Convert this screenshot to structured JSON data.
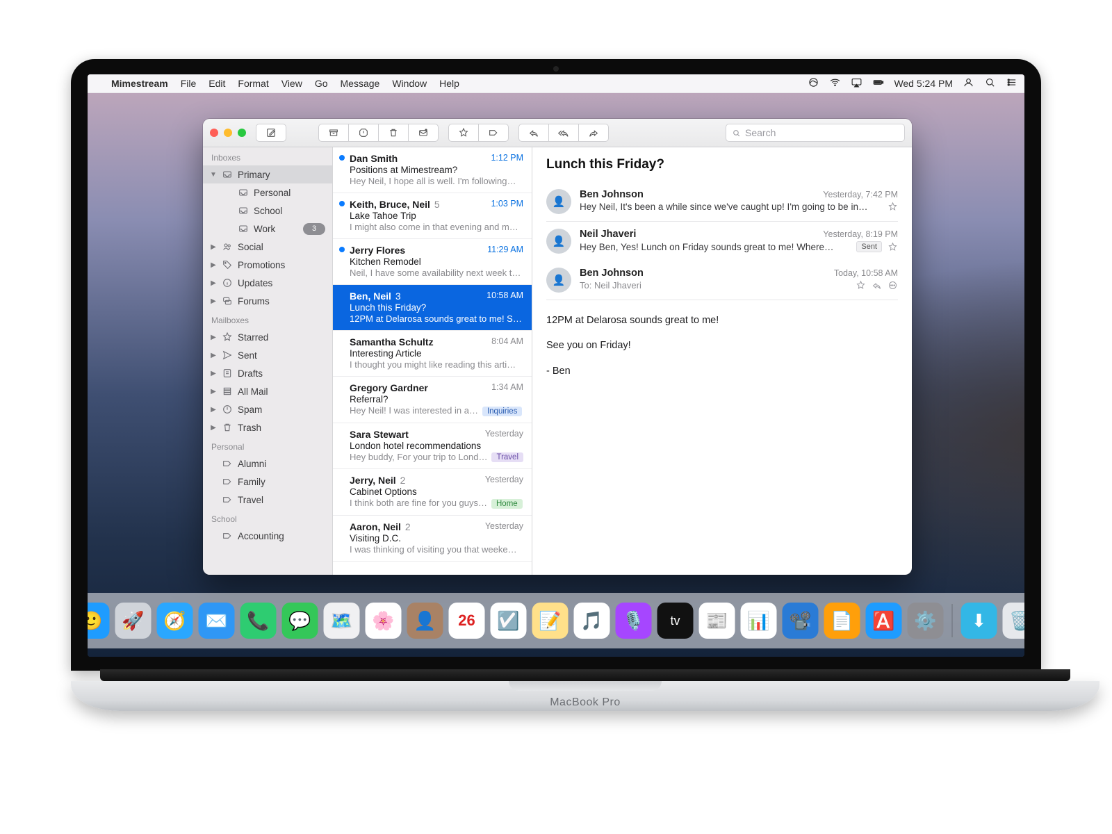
{
  "menubar": {
    "app": "Mimestream",
    "items": [
      "File",
      "Edit",
      "Format",
      "View",
      "Go",
      "Message",
      "Window",
      "Help"
    ],
    "clock": "Wed 5:24 PM"
  },
  "search": {
    "placeholder": "Search"
  },
  "sidebar": {
    "groups": [
      {
        "title": "Inboxes",
        "items": [
          {
            "label": "Primary",
            "icon": "tray",
            "chev": "down",
            "sel": true
          },
          {
            "label": "Personal",
            "icon": "tray",
            "indent": true
          },
          {
            "label": "School",
            "icon": "tray",
            "indent": true
          },
          {
            "label": "Work",
            "icon": "tray",
            "indent": true,
            "badge": "3"
          },
          {
            "label": "Social",
            "icon": "people",
            "chev": "right"
          },
          {
            "label": "Promotions",
            "icon": "tag",
            "chev": "right"
          },
          {
            "label": "Updates",
            "icon": "info",
            "chev": "right"
          },
          {
            "label": "Forums",
            "icon": "forum",
            "chev": "right"
          }
        ]
      },
      {
        "title": "Mailboxes",
        "items": [
          {
            "label": "Starred",
            "icon": "star",
            "chev": "right"
          },
          {
            "label": "Sent",
            "icon": "send",
            "chev": "right"
          },
          {
            "label": "Drafts",
            "icon": "draft",
            "chev": "right"
          },
          {
            "label": "All Mail",
            "icon": "stack",
            "chev": "right"
          },
          {
            "label": "Spam",
            "icon": "spam",
            "chev": "right"
          },
          {
            "label": "Trash",
            "icon": "trash",
            "chev": "right"
          }
        ]
      },
      {
        "title": "Personal",
        "items": [
          {
            "label": "Alumni",
            "icon": "label"
          },
          {
            "label": "Family",
            "icon": "label"
          },
          {
            "label": "Travel",
            "icon": "label"
          }
        ]
      },
      {
        "title": "School",
        "items": [
          {
            "label": "Accounting",
            "icon": "label"
          }
        ]
      }
    ]
  },
  "messages": [
    {
      "unread": true,
      "from": "Dan Smith",
      "subject": "Positions at Mimestream?",
      "preview": "Hey Neil, I hope all is well. I'm following…",
      "time": "1:12 PM"
    },
    {
      "unread": true,
      "from": "Keith, Bruce, Neil",
      "count": "5",
      "subject": "Lake Tahoe Trip",
      "preview": "I might also come in that evening and m…",
      "time": "1:03 PM"
    },
    {
      "unread": true,
      "from": "Jerry Flores",
      "subject": "Kitchen Remodel",
      "preview": "Neil, I have some availability next week t…",
      "time": "11:29 AM"
    },
    {
      "sel": true,
      "from": "Ben, Neil",
      "count": "3",
      "subject": "Lunch this Friday?",
      "preview": "12PM at Delarosa sounds great to me! S…",
      "time": "10:58 AM"
    },
    {
      "from": "Samantha Schultz",
      "subject": "Interesting Article",
      "preview": "I thought you might like reading this arti…",
      "time": "8:04 AM"
    },
    {
      "from": "Gregory Gardner",
      "subject": "Referral?",
      "preview": "Hey Neil! I was interested in a…",
      "time": "1:34 AM",
      "tag": {
        "text": "Inquiries",
        "bg": "#d9e6fb",
        "fg": "#2b5db0"
      }
    },
    {
      "from": "Sara Stewart",
      "subject": "London hotel recommendations",
      "preview": "Hey buddy, For your trip to Lond…",
      "time": "Yesterday",
      "tag": {
        "text": "Travel",
        "bg": "#e6def5",
        "fg": "#6b4fa8"
      }
    },
    {
      "from": "Jerry, Neil",
      "count": "2",
      "subject": "Cabinet Options",
      "preview": "I think both are fine for you guys…",
      "time": "Yesterday",
      "tag": {
        "text": "Home",
        "bg": "#d7f0d8",
        "fg": "#2f8a3f"
      }
    },
    {
      "from": "Aaron, Neil",
      "count": "2",
      "subject": "Visiting D.C.",
      "preview": "I was thinking of visiting you that weeke…",
      "time": "Yesterday"
    }
  ],
  "reader": {
    "subject": "Lunch this Friday?",
    "thread": [
      {
        "sender": "Ben Johnson",
        "when": "Yesterday, 7:42 PM",
        "snippet": "Hey Neil, It's been a while since we've caught up! I'm going to be in…",
        "star": true
      },
      {
        "sender": "Neil Jhaveri",
        "when": "Yesterday, 8:19 PM",
        "snippet": "Hey Ben, Yes! Lunch on Friday sounds great to me! Where…",
        "sent": true,
        "star": true
      }
    ],
    "expanded": {
      "sender": "Ben Johnson",
      "when": "Today, 10:58 AM",
      "to_label": "To:",
      "to_name": "Neil Jhaveri",
      "body_lines": [
        "12PM at Delarosa sounds great to me!",
        "See you on Friday!",
        "- Ben"
      ]
    }
  },
  "brand": "MacBook Pro",
  "dock": {
    "apps": [
      {
        "n": "finder",
        "bg": "#1e9cff",
        "g": "🙂"
      },
      {
        "n": "launchpad",
        "bg": "#d0d4da",
        "g": "🚀"
      },
      {
        "n": "safari",
        "bg": "#2aa7ff",
        "g": "🧭"
      },
      {
        "n": "mail",
        "bg": "#2f97f5",
        "g": "✉️"
      },
      {
        "n": "facetime",
        "bg": "#2ecc71",
        "g": "📞"
      },
      {
        "n": "messages",
        "bg": "#34c759",
        "g": "💬"
      },
      {
        "n": "maps",
        "bg": "#f0f0f2",
        "g": "🗺️"
      },
      {
        "n": "photos",
        "bg": "#ffffff",
        "g": "🌸"
      },
      {
        "n": "contacts",
        "bg": "#a98265",
        "g": "👤"
      },
      {
        "n": "calendar",
        "bg": "#ffffff",
        "g": "26"
      },
      {
        "n": "reminders",
        "bg": "#ffffff",
        "g": "☑️"
      },
      {
        "n": "notes",
        "bg": "#ffe08a",
        "g": "📝"
      },
      {
        "n": "music",
        "bg": "#ffffff",
        "g": "🎵"
      },
      {
        "n": "podcasts",
        "bg": "#a646ff",
        "g": "🎙️"
      },
      {
        "n": "tv",
        "bg": "#111",
        "g": "tv"
      },
      {
        "n": "news",
        "bg": "#ffffff",
        "g": "📰"
      },
      {
        "n": "numbers",
        "bg": "#ffffff",
        "g": "📊"
      },
      {
        "n": "keynote",
        "bg": "#2a7bd6",
        "g": "📽️"
      },
      {
        "n": "pages",
        "bg": "#ff9f0a",
        "g": "📄"
      },
      {
        "n": "appstore",
        "bg": "#1e9cff",
        "g": "🅰️"
      },
      {
        "n": "settings",
        "bg": "#8e8e93",
        "g": "⚙️"
      }
    ],
    "right": [
      {
        "n": "downloads",
        "bg": "#33b7e6",
        "g": "⬇︎"
      },
      {
        "n": "trash",
        "bg": "#e6e8ec",
        "g": "🗑️"
      }
    ]
  }
}
